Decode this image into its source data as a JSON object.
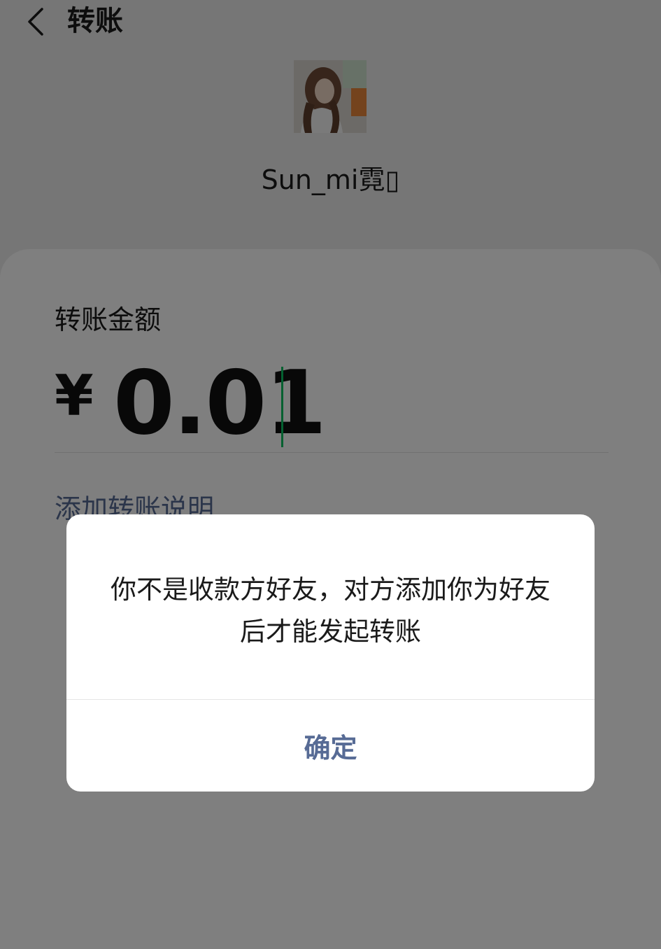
{
  "header": {
    "title": "转账",
    "back_icon": "chevron-left-icon"
  },
  "payee": {
    "nickname": "Sun_mi霓▯"
  },
  "transfer": {
    "amount_label": "转账金额",
    "currency_symbol": "¥",
    "amount": "0.01",
    "add_note_label": "添加转账说明"
  },
  "dialog": {
    "message": "你不是收款方好友，对方添加你为好友后才能发起转账",
    "confirm_label": "确定"
  },
  "colors": {
    "link_blue": "#576b95",
    "cursor_green": "#07c160",
    "overlay": "rgba(0,0,0,0.5)"
  }
}
